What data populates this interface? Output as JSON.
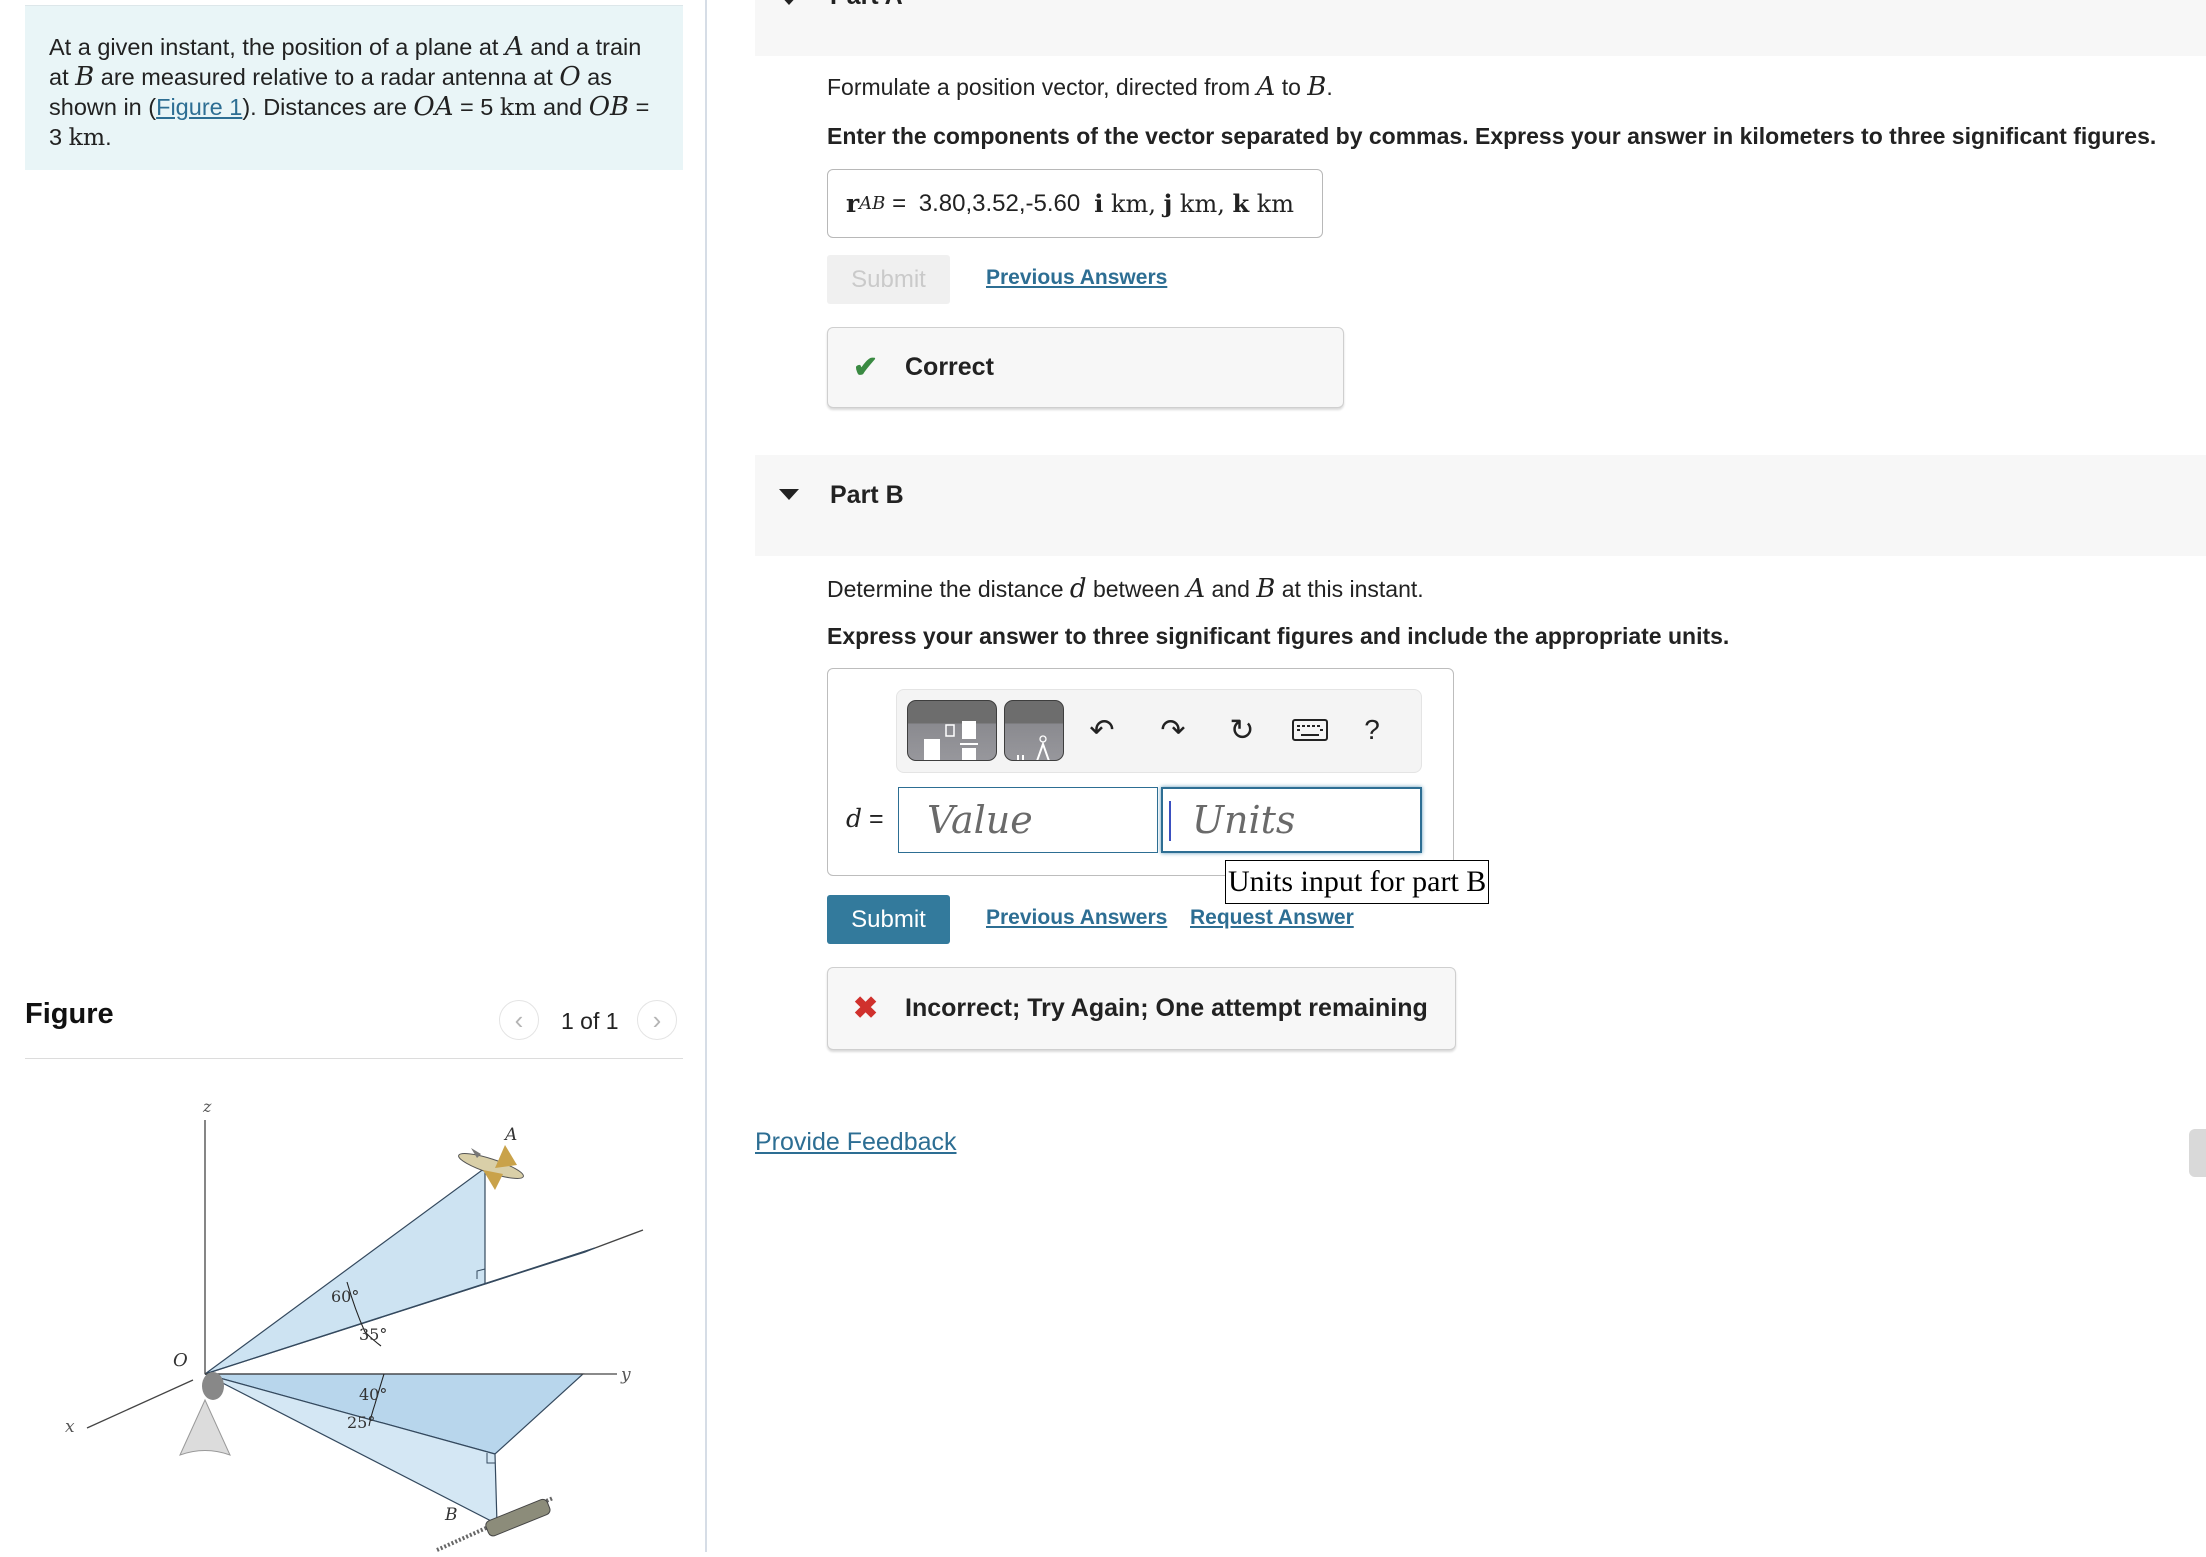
{
  "problem": {
    "text_parts": [
      "At a given instant, the position of a plane at ",
      "A",
      " and a train at ",
      "B",
      " are measured relative to a radar antenna at ",
      "O",
      " as shown in (",
      "Figure 1",
      "). Distances are ",
      "OA",
      " = 5 ",
      "km",
      " and ",
      "OB",
      " = 3 ",
      "km",
      "."
    ]
  },
  "figure": {
    "title": "Figure",
    "pager_text": "1 of 1",
    "prev_icon": "chevron-left-icon",
    "next_icon": "chevron-right-icon",
    "labels": {
      "z": "z",
      "x": "x",
      "y": "y",
      "O": "O",
      "A": "A",
      "B": "B",
      "angle1": "60°",
      "angle2": "35°",
      "angle3": "40°",
      "angle4": "25°"
    }
  },
  "partA": {
    "title": "Part A",
    "prompt_parts": [
      "Formulate a position vector, directed from ",
      "A",
      " to ",
      "B",
      "."
    ],
    "instruction": "Enter the components of the vector separated by commas. Express your answer in kilometers to three significant figures.",
    "answer_label_vec": "r",
    "answer_label_sub": "AB",
    "equals": " = ",
    "answer_value": "3.80,3.52,-5.60",
    "unit_i": "i",
    "unit_j": "j",
    "unit_k": "k",
    "unit_km": "km",
    "submit_label": "Submit",
    "previous_answers_label": "Previous Answers",
    "feedback": {
      "status": "correct",
      "text": "Correct",
      "icon": "checkmark-icon",
      "color": "#3a8a42"
    }
  },
  "partB": {
    "title": "Part B",
    "prompt_parts": [
      "Determine the distance ",
      "d",
      " between ",
      "A",
      " and ",
      "B",
      " at this instant."
    ],
    "instruction": "Express your answer to three significant figures and include the appropriate units.",
    "toolbar": {
      "templates_icon": "templates-icon",
      "units_icon": "units-symbol-icon",
      "undo_icon": "undo-icon",
      "redo_icon": "redo-icon",
      "reset_icon": "reset-icon",
      "keyboard_icon": "keyboard-icon",
      "help_label": "?"
    },
    "var_label": "d",
    "equals": " =",
    "value_placeholder": "Value",
    "units_placeholder": "Units",
    "tooltip": "Units input for part B",
    "submit_label": "Submit",
    "previous_answers_label": "Previous Answers",
    "request_answer_label": "Request Answer",
    "feedback": {
      "status": "incorrect",
      "text": "Incorrect; Try Again; One attempt remaining",
      "icon": "cross-icon",
      "color": "#d0312d"
    }
  },
  "footer": {
    "provide_feedback_label": "Provide Feedback"
  },
  "colors": {
    "accent": "#2d6e93",
    "submit_bg": "#337a9c",
    "problem_bg": "#e9f5f7",
    "part_band_bg": "#f7f7f7"
  }
}
